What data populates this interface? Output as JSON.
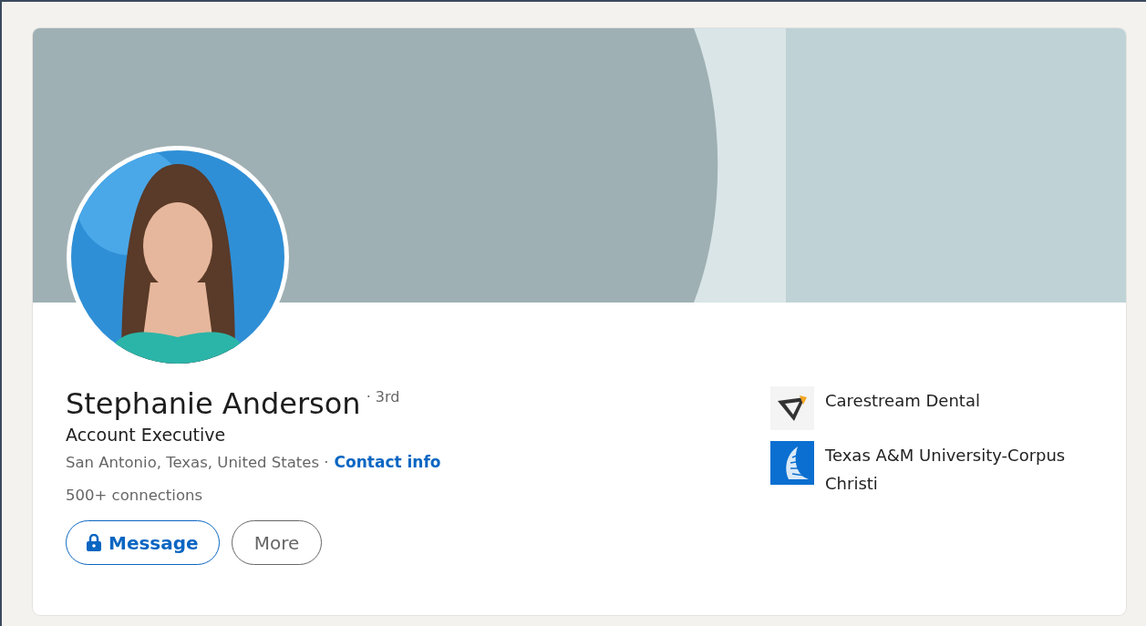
{
  "profile": {
    "name": "Stephanie Anderson",
    "degree": "· 3rd",
    "headline": "Account Executive",
    "location": "San Antonio, Texas, United States ·",
    "contact_link": "Contact info",
    "connections": "500+ connections"
  },
  "buttons": [
    {
      "label": "Message",
      "kind": "primary"
    },
    {
      "label": "More",
      "kind": "secondary"
    }
  ],
  "affiliations": [
    {
      "name": "Carestream Dental",
      "kind": "company"
    },
    {
      "name": "Texas A&M University-Corpus Christi",
      "kind": "school"
    }
  ]
}
